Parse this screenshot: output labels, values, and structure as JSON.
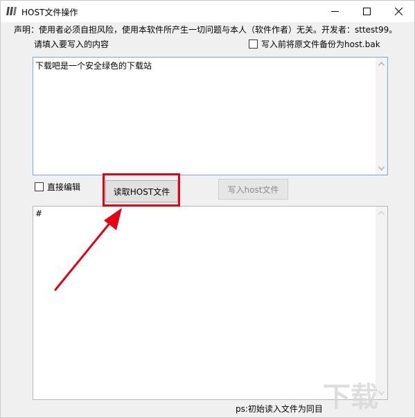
{
  "window": {
    "title": "HOST文件操作",
    "controls": {
      "minimize": "—",
      "maximize": "☐",
      "close": "✕"
    }
  },
  "notice": "声明：使用者必须自担风险，使用本软件所产生一切问题与本人（软件作者）无关。开发者：sttest99。",
  "input_section": {
    "label": "请填入要写入的内容",
    "backup_checkbox": {
      "label": "写入前将原文件备份为host.bak",
      "checked": false
    },
    "content": "下载吧是一个安全绿色的下载站"
  },
  "controls": {
    "direct_edit_checkbox": {
      "label": "直接编辑",
      "checked": false
    },
    "read_button": "读取HOST文件",
    "write_button": "写入host文件"
  },
  "output_section": {
    "content": "#"
  },
  "footer": {
    "ps_text": "ps:初始读入文件为同目"
  },
  "annotation": {
    "highlight_color": "#e60012"
  },
  "icons": {
    "app": "app-logo-icon",
    "scroll_up": "chevron-up-icon",
    "scroll_down": "chevron-down-icon",
    "arrow": "red-arrow-icon"
  }
}
